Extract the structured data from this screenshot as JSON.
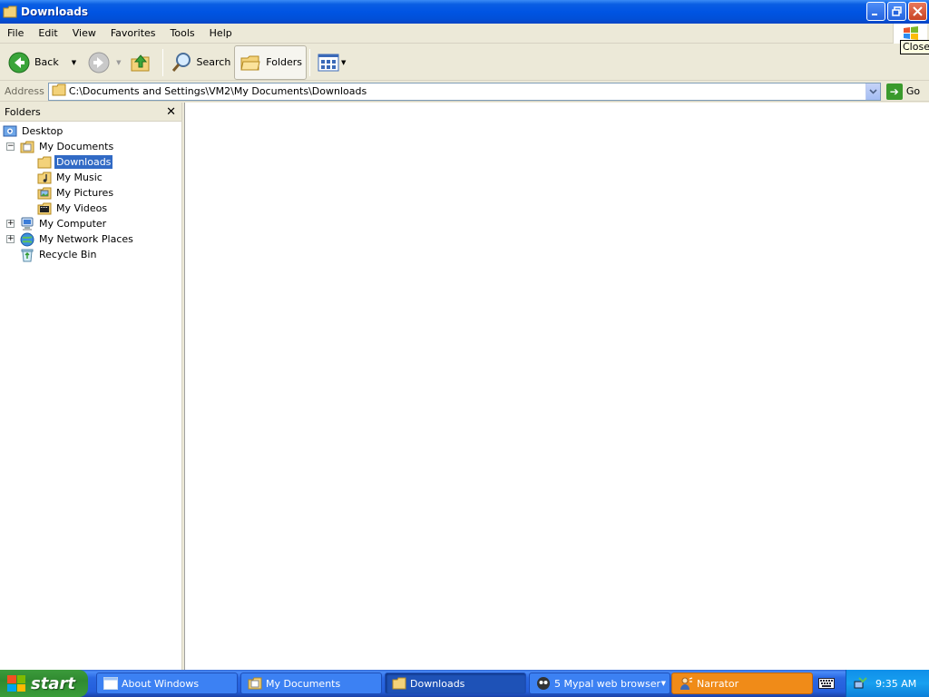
{
  "window": {
    "title": "Downloads",
    "tooltip": "Close"
  },
  "menu": [
    "File",
    "Edit",
    "View",
    "Favorites",
    "Tools",
    "Help"
  ],
  "toolbar": {
    "back_label": "Back",
    "search_label": "Search",
    "folders_label": "Folders"
  },
  "address": {
    "label": "Address",
    "value": "C:\\Documents and Settings\\VM2\\My Documents\\Downloads",
    "go_label": "Go"
  },
  "folders_pane": {
    "title": "Folders",
    "tree": [
      {
        "label": "Desktop",
        "icon": "desktop-icon",
        "level": 0,
        "expander": "",
        "selected": false
      },
      {
        "label": "My Documents",
        "icon": "my-documents-icon",
        "level": 1,
        "expander": "minus",
        "selected": false
      },
      {
        "label": "Downloads",
        "icon": "folder-icon",
        "level": 2,
        "expander": "",
        "selected": true
      },
      {
        "label": "My Music",
        "icon": "music-folder-icon",
        "level": 2,
        "expander": "",
        "selected": false
      },
      {
        "label": "My Pictures",
        "icon": "pictures-folder-icon",
        "level": 2,
        "expander": "",
        "selected": false
      },
      {
        "label": "My Videos",
        "icon": "videos-folder-icon",
        "level": 2,
        "expander": "",
        "selected": false
      },
      {
        "label": "My Computer",
        "icon": "computer-icon",
        "level": 1,
        "expander": "plus",
        "selected": false
      },
      {
        "label": "My Network Places",
        "icon": "network-icon",
        "level": 1,
        "expander": "plus",
        "selected": false
      },
      {
        "label": "Recycle Bin",
        "icon": "recycle-bin-icon",
        "level": 1,
        "expander": "",
        "selected": false
      }
    ]
  },
  "taskbar": {
    "start_label": "start",
    "tasks": [
      {
        "label": "About Windows",
        "icon": "window-icon"
      },
      {
        "label": "My Documents",
        "icon": "my-documents-icon"
      },
      {
        "label": "Downloads",
        "icon": "folder-icon"
      },
      {
        "label": "5 Mypal web browser",
        "icon": "browser-icon"
      },
      {
        "label": "Narrator",
        "icon": "narrator-icon"
      }
    ],
    "clock": "9:35 AM"
  },
  "colors": {
    "title_bar": "#0054e3",
    "selection": "#316ac5",
    "start_button": "#3a9d3a",
    "narrator_task": "#f08b18",
    "tray": "#0f8fe9"
  }
}
